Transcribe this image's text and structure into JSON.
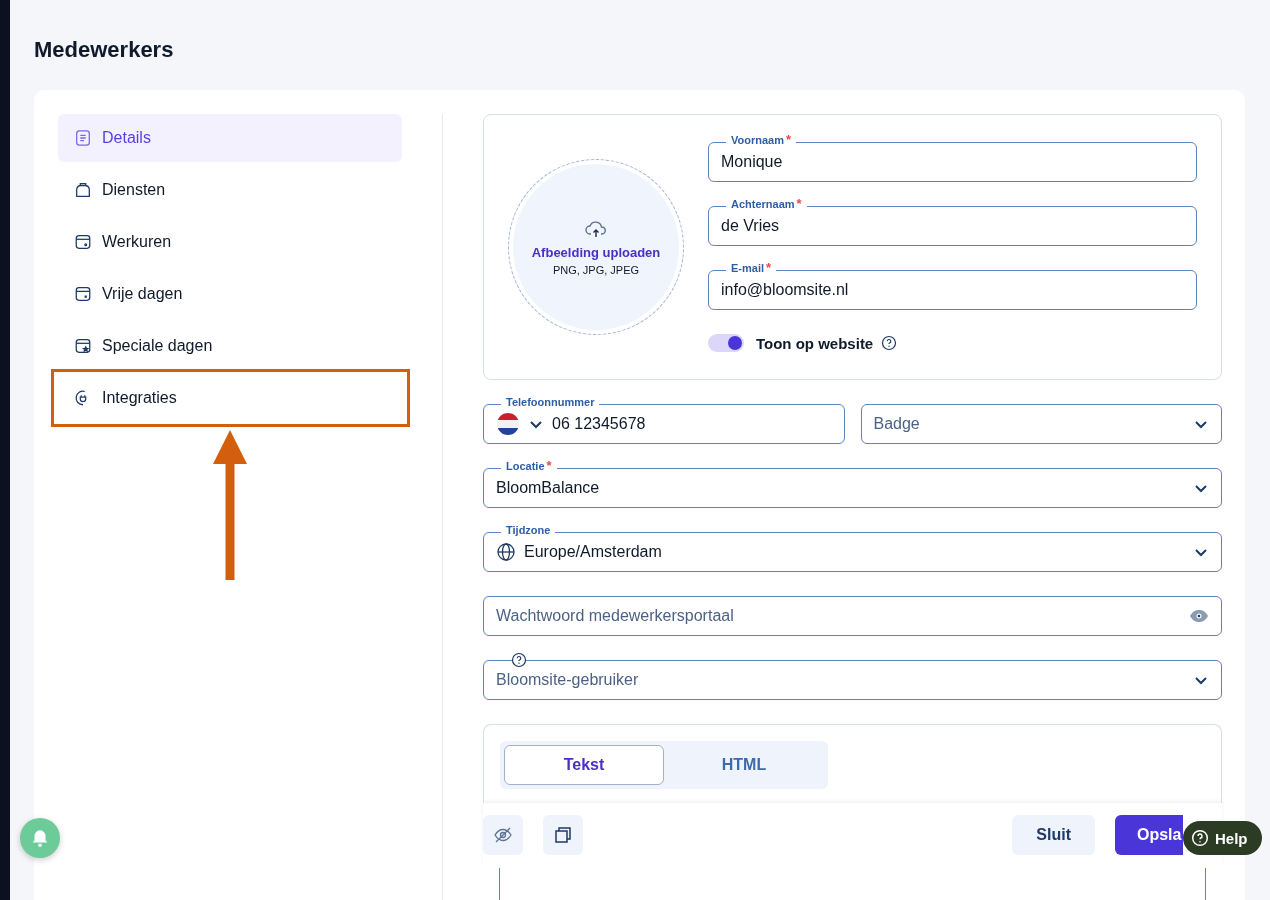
{
  "page_title": "Medewerkers",
  "sidebar": {
    "items": [
      {
        "label": "Details",
        "selected": true,
        "highlighted": false
      },
      {
        "label": "Diensten",
        "selected": false,
        "highlighted": false
      },
      {
        "label": "Werkuren",
        "selected": false,
        "highlighted": false
      },
      {
        "label": "Vrije dagen",
        "selected": false,
        "highlighted": false
      },
      {
        "label": "Speciale dagen",
        "selected": false,
        "highlighted": false
      },
      {
        "label": "Integraties",
        "selected": false,
        "highlighted": true
      }
    ]
  },
  "upload": {
    "title": "Afbeelding uploaden",
    "formats": "PNG, JPG, JPEG"
  },
  "name_fields": [
    {
      "label": "Voornaam",
      "required_mark": "*",
      "value": "Monique"
    },
    {
      "label": "Achternaam",
      "required_mark": "*",
      "value": "de Vries"
    },
    {
      "label": "E-mail",
      "required_mark": "*",
      "value": "info@bloomsite.nl"
    }
  ],
  "show_on_website": {
    "label": "Toon op website",
    "on": true
  },
  "phone": {
    "label": "Telefoonnummer",
    "value": "06 12345678"
  },
  "badge": {
    "placeholder": "Badge"
  },
  "location": {
    "label": "Locatie",
    "required_mark": "*",
    "value": "BloomBalance"
  },
  "timezone": {
    "label": "Tijdzone",
    "value": "Europe/Amsterdam"
  },
  "password": {
    "placeholder": "Wachtwoord medewerkersportaal"
  },
  "user": {
    "placeholder": "Bloomsite-gebruiker"
  },
  "editor_tabs": [
    {
      "label": "Tekst",
      "selected": true
    },
    {
      "label": "HTML",
      "selected": false
    }
  ],
  "footer_buttons": [
    {
      "label": "Sluit",
      "kind": "secondary"
    },
    {
      "label": "Opsla",
      "kind": "primary"
    }
  ],
  "help": {
    "label": "Help"
  }
}
